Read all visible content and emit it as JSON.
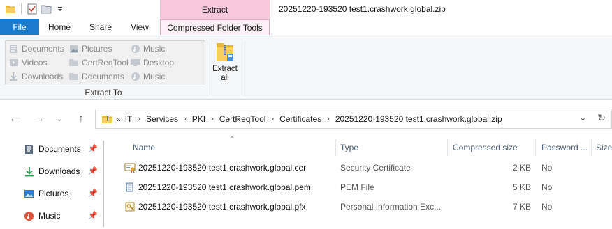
{
  "window": {
    "title": "20251220-193520 test1.crashwork.global.zip",
    "context_tab_group": "Extract"
  },
  "quick_access_toolbar": {
    "icons": [
      "folder-icon",
      "properties-check-icon",
      "new-folder-icon",
      "customize-dropdown-icon"
    ]
  },
  "ribbon_tabs": {
    "file": "File",
    "home": "Home",
    "share": "Share",
    "view": "View",
    "compressed": "Compressed Folder Tools"
  },
  "extract_to": {
    "group_label": "Extract To",
    "items": [
      {
        "label": "Documents",
        "icon": "documents-icon"
      },
      {
        "label": "Pictures",
        "icon": "pictures-icon"
      },
      {
        "label": "Music",
        "icon": "music-icon"
      },
      {
        "label": "Videos",
        "icon": "videos-icon"
      },
      {
        "label": "CertReqTool",
        "icon": "folder-icon"
      },
      {
        "label": "Desktop",
        "icon": "desktop-icon"
      },
      {
        "label": "Downloads",
        "icon": "downloads-icon"
      },
      {
        "label": "Documents",
        "icon": "folder-icon"
      },
      {
        "label": "Music",
        "icon": "music-icon"
      }
    ],
    "extract_all_line1": "Extract",
    "extract_all_line2": "all"
  },
  "address": {
    "prefix": "«",
    "crumbs": [
      "IT",
      "Services",
      "PKI",
      "CertReqTool",
      "Certificates",
      "20251220-193520 test1.crashwork.global.zip"
    ]
  },
  "nav_pane": {
    "items": [
      {
        "label": "Documents",
        "icon": "documents-icon",
        "pinned": true
      },
      {
        "label": "Downloads",
        "icon": "downloads-icon",
        "pinned": true
      },
      {
        "label": "Pictures",
        "icon": "pictures-icon",
        "pinned": true
      },
      {
        "label": "Music",
        "icon": "music-icon",
        "pinned": true
      }
    ]
  },
  "file_list": {
    "columns": {
      "name": "Name",
      "type": "Type",
      "compressed_size": "Compressed size",
      "password": "Password ...",
      "size": "Size"
    },
    "rows": [
      {
        "name": "20251220-193520 test1.crashwork.global.cer",
        "type": "Security Certificate",
        "compressed_size": "2 KB",
        "password": "No",
        "icon": "certificate-icon"
      },
      {
        "name": "20251220-193520 test1.crashwork.global.pem",
        "type": "PEM File",
        "compressed_size": "5 KB",
        "password": "No",
        "icon": "pem-file-icon"
      },
      {
        "name": "20251220-193520 test1.crashwork.global.pfx",
        "type": "Personal Information Exc...",
        "compressed_size": "7 KB",
        "password": "No",
        "icon": "pfx-file-icon"
      }
    ]
  },
  "colors": {
    "file_tab": "#1979ca",
    "context_tab": "#f8c8dc",
    "column_header_text": "#4c607a"
  }
}
